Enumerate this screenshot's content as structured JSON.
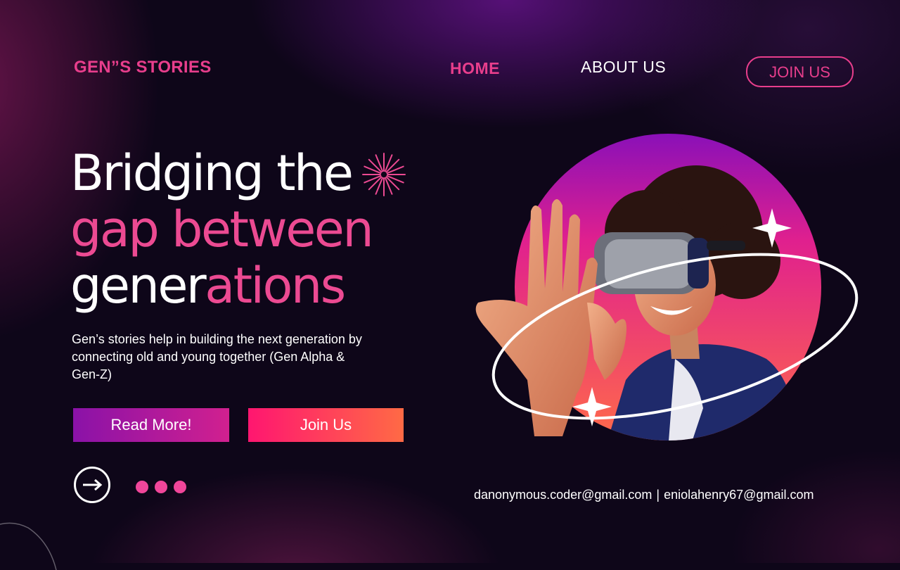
{
  "brand": "GEN”S STORIES",
  "nav": {
    "home": "HOME",
    "about": "ABOUT US",
    "join": "JOIN US"
  },
  "hero": {
    "line1": "Bridging the",
    "line2": "gap between",
    "line3_white": "gener",
    "line3_pink": "ations",
    "description": "Gen’s stories help in building the next generation by connecting old and young together (Gen Alpha & Gen-Z)",
    "read_more": "Read More!",
    "join_us": "Join Us",
    "image_alt": "person-wearing-vr-headset"
  },
  "contacts": {
    "email1": "danonymous.coder@gmail.com",
    "separator": "|",
    "email2": "eniolahenry67@gmail.com"
  },
  "pagination": {
    "dots": 3
  },
  "colors": {
    "accent": "#e83e8c",
    "background": "#0e0619",
    "read_more_gradient": [
      "#8a12a8",
      "#d1208f"
    ],
    "join_gradient": [
      "#ff1670",
      "#ff6a45"
    ]
  },
  "icons": [
    "sparkle-burst-icon",
    "arrow-right-icon",
    "star-sparkle-icon"
  ]
}
